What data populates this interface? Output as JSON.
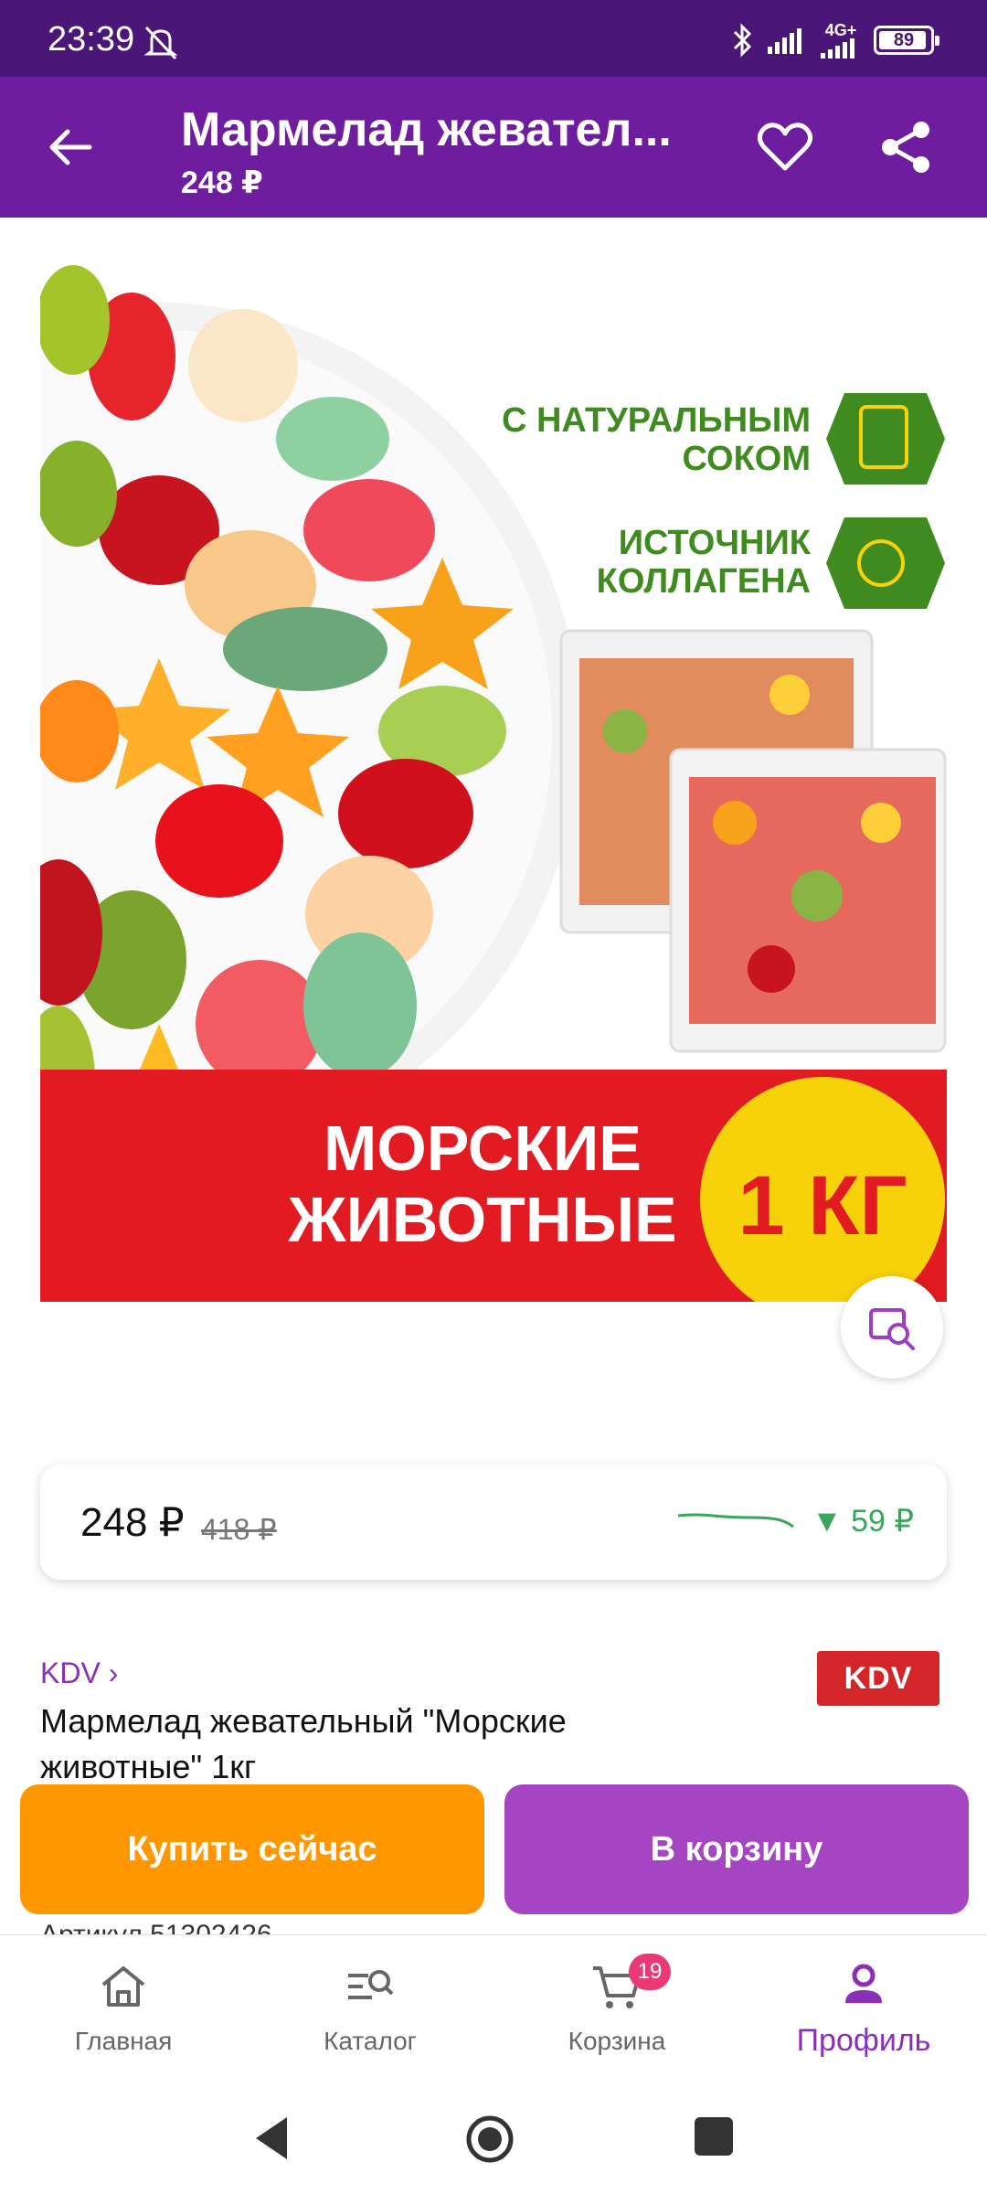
{
  "status_bar": {
    "time": "23:39",
    "network": "4G+",
    "battery": "89"
  },
  "app_bar": {
    "title": "Мармелад жевател...",
    "price": "248 ₽"
  },
  "product_image": {
    "tag1": "С НАТУРАЛЬНЫМ СОКОМ",
    "tag2": "ИСТОЧНИК КОЛЛАГЕНА",
    "banner_line1": "МОРСКИЕ",
    "banner_line2": "ЖИВОТНЫЕ",
    "weight_badge": "1 КГ"
  },
  "price_card": {
    "price": "248 ₽",
    "old_price": "418 ₽",
    "drop": "▼ 59 ₽"
  },
  "brand": {
    "label": "KDV ›",
    "logo_text": "KDV"
  },
  "product": {
    "name": "Мармелад жевательный \"Морские животные\" 1кг",
    "article": "Артикул 51302426"
  },
  "actions": {
    "buy_now": "Купить сейчас",
    "add_to_cart": "В корзину"
  },
  "bottom_nav": {
    "items": [
      {
        "label": "Главная",
        "icon": "home-icon"
      },
      {
        "label": "Каталог",
        "icon": "catalog-search-icon"
      },
      {
        "label": "Корзина",
        "icon": "cart-icon"
      },
      {
        "label": "Профиль",
        "icon": "profile-icon"
      }
    ],
    "cart_badge": "19",
    "active": "Профиль"
  },
  "colors": {
    "status_bar": "#4a1779",
    "app_bar": "#6e1d9f",
    "buy_now": "#ff9800",
    "add_to_cart": "#a545c4",
    "accent": "#8a2fb8",
    "banner_red": "#e21a22",
    "badge_yellow": "#f7d10a",
    "tag_green": "#3f8b1f"
  }
}
